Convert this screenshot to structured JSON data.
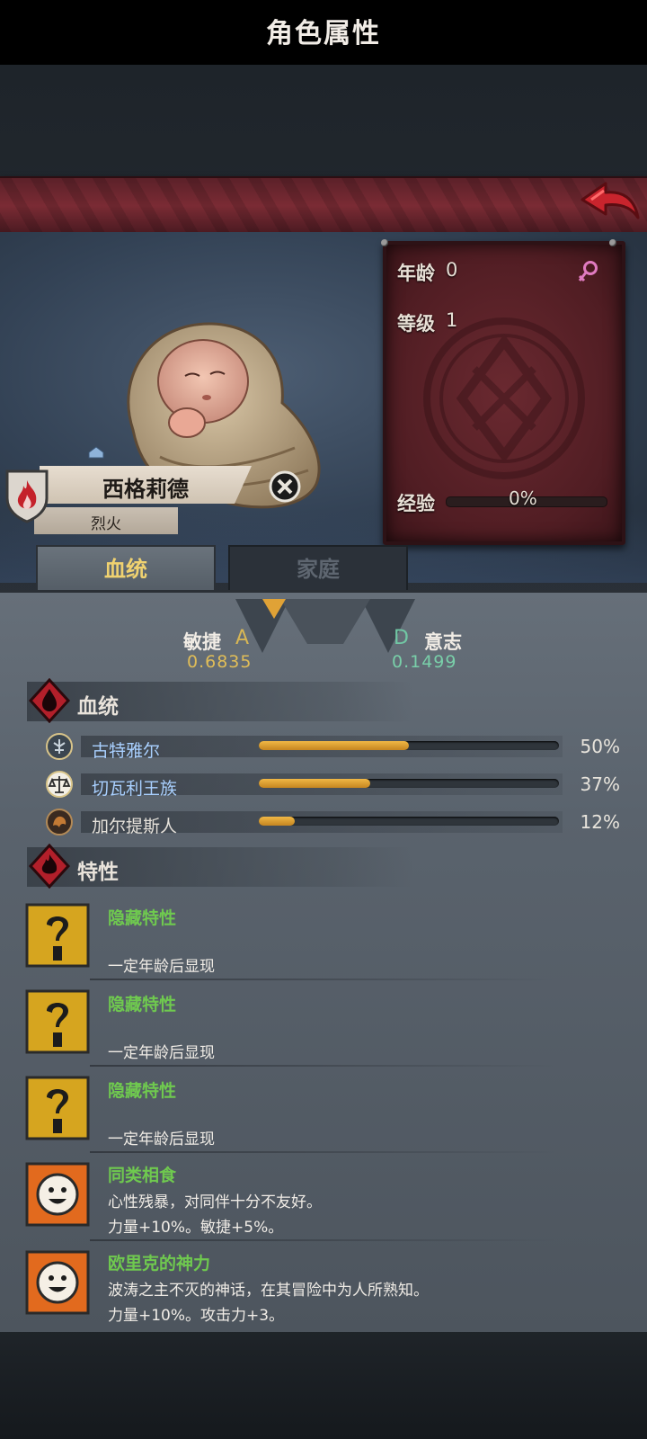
{
  "header": {
    "title": "角色属性"
  },
  "character": {
    "name": "西格莉德",
    "subtitle": "烈火",
    "stats": {
      "age_label": "年龄",
      "age_value": "0",
      "level_label": "等级",
      "level_value": "1",
      "exp_label": "经验",
      "exp_value": "0%",
      "exp_fraction": 0
    }
  },
  "tabs": [
    {
      "label": "血统",
      "active": true
    },
    {
      "label": "家庭",
      "active": false
    }
  ],
  "attributes": {
    "left": {
      "name": "敏捷",
      "grade": "A",
      "value": "0.6835"
    },
    "right": {
      "name": "意志",
      "grade": "D",
      "value": "0.1499"
    }
  },
  "lineage_section": {
    "title": "血统",
    "items": [
      {
        "name": "古特雅尔",
        "percent": "50%",
        "fraction": 0.5,
        "icon": "tree-emblem-icon"
      },
      {
        "name": "切瓦利王族",
        "percent": "37%",
        "fraction": 0.37,
        "icon": "scales-emblem-icon"
      },
      {
        "name": "加尔提斯人",
        "percent": "12%",
        "fraction": 0.12,
        "icon": "beast-emblem-icon"
      }
    ]
  },
  "traits_section": {
    "title": "特性",
    "items": [
      {
        "name": "隐藏特性",
        "line1": "",
        "line2": "一定年龄后显现",
        "icon": "question-mark-icon"
      },
      {
        "name": "隐藏特性",
        "line1": "",
        "line2": "一定年龄后显现",
        "icon": "question-mark-icon"
      },
      {
        "name": "隐藏特性",
        "line1": "",
        "line2": "一定年龄后显现",
        "icon": "question-mark-icon"
      },
      {
        "name": "同类相食",
        "line1": "心性残暴，对同伴十分不友好。",
        "line2": "力量+10%。敏捷+5%。",
        "icon": "smiley-face-icon"
      },
      {
        "name": "欧里克的神力",
        "line1": "波涛之主不灭的神话，在其冒险中为人所熟知。",
        "line2": "力量+10%。攻击力+3。",
        "icon": "smiley-face-icon"
      }
    ]
  },
  "colors": {
    "banner": "#7a2b34",
    "stats_panel": "#5a2128",
    "active_tab_text": "#f0d270",
    "lineage_bar": "#e0a236",
    "trait_name": "#6fc94f",
    "grade_a": "#d7b655",
    "grade_d": "#71c7a4"
  }
}
